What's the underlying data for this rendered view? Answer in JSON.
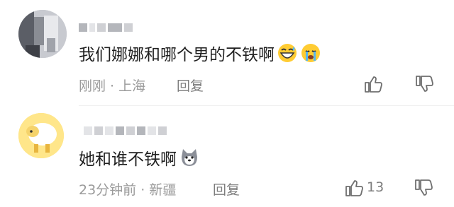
{
  "comments": [
    {
      "text": "我们娜娜和哪个男的不铁啊",
      "emojis": [
        "grinning-sweat-emoji",
        "crying-emoji"
      ],
      "time": "刚刚",
      "location": "上海",
      "reply_label": "回复",
      "likes": ""
    },
    {
      "text": "她和谁不铁啊",
      "emojis": [
        "husky-emoji"
      ],
      "time": "23分钟前",
      "location": "新疆",
      "reply_label": "回复",
      "likes": "13"
    }
  ],
  "meta_separator": " · ",
  "colors": {
    "text": "#1f1f1f",
    "meta": "#9a9a9a",
    "action": "#7d7d7d"
  }
}
